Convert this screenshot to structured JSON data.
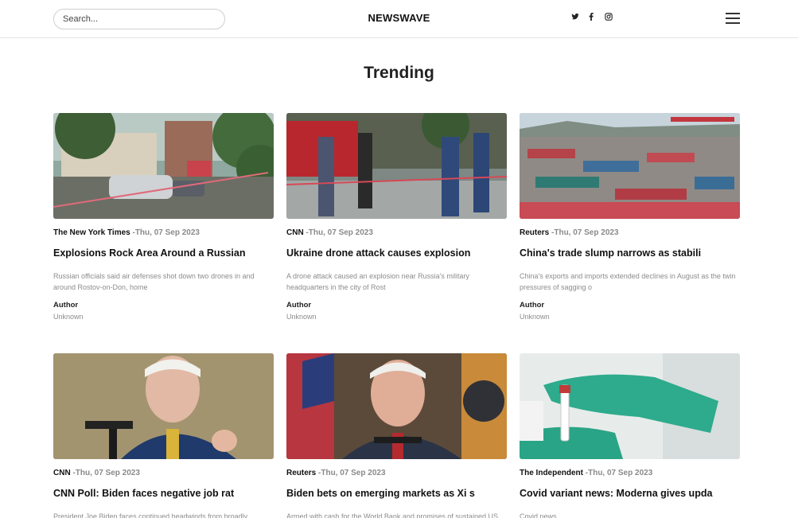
{
  "header": {
    "search_placeholder": "Search...",
    "logo": "NEWSWAVE",
    "social_icons": [
      "twitter-icon",
      "facebook-icon",
      "instagram-icon"
    ],
    "menu_icon": "hamburger-menu-icon"
  },
  "section": {
    "title": "Trending"
  },
  "articles": [
    {
      "source": "The New York Times",
      "date": " -Thu, 07 Sep 2023",
      "title": "Explosions Rock Area Around a Russian",
      "description": "Russian officials said air defenses shot down two drones in and around Rostov-on-Don, home",
      "author_label": "Author",
      "author": "Unknown"
    },
    {
      "source": "CNN",
      "date": " -Thu, 07 Sep 2023",
      "title": "Ukraine drone attack causes explosion",
      "description": "A drone attack caused an explosion near Russia's military headquarters in the city of Rost",
      "author_label": "Author",
      "author": "Unknown"
    },
    {
      "source": "Reuters",
      "date": " -Thu, 07 Sep 2023",
      "title": "China's trade slump narrows as stabili",
      "description": "China's exports and imports extended declines in August as the twin pressures of sagging o",
      "author_label": "Author",
      "author": "Unknown"
    },
    {
      "source": "CNN",
      "date": " -Thu, 07 Sep 2023",
      "title": "CNN Poll: Biden faces negative job rat",
      "description": "President Joe Biden faces continued headwinds from broadly",
      "author_label": "",
      "author": ""
    },
    {
      "source": "Reuters",
      "date": " -Thu, 07 Sep 2023",
      "title": "Biden bets on emerging markets as Xi s",
      "description": "Armed with cash for the World Bank and promises of sustained US",
      "author_label": "",
      "author": ""
    },
    {
      "source": "The Independent",
      "date": " -Thu, 07 Sep 2023",
      "title": "Covid variant news: Moderna gives upda",
      "description": "Covid news",
      "author_label": "",
      "author": ""
    }
  ]
}
